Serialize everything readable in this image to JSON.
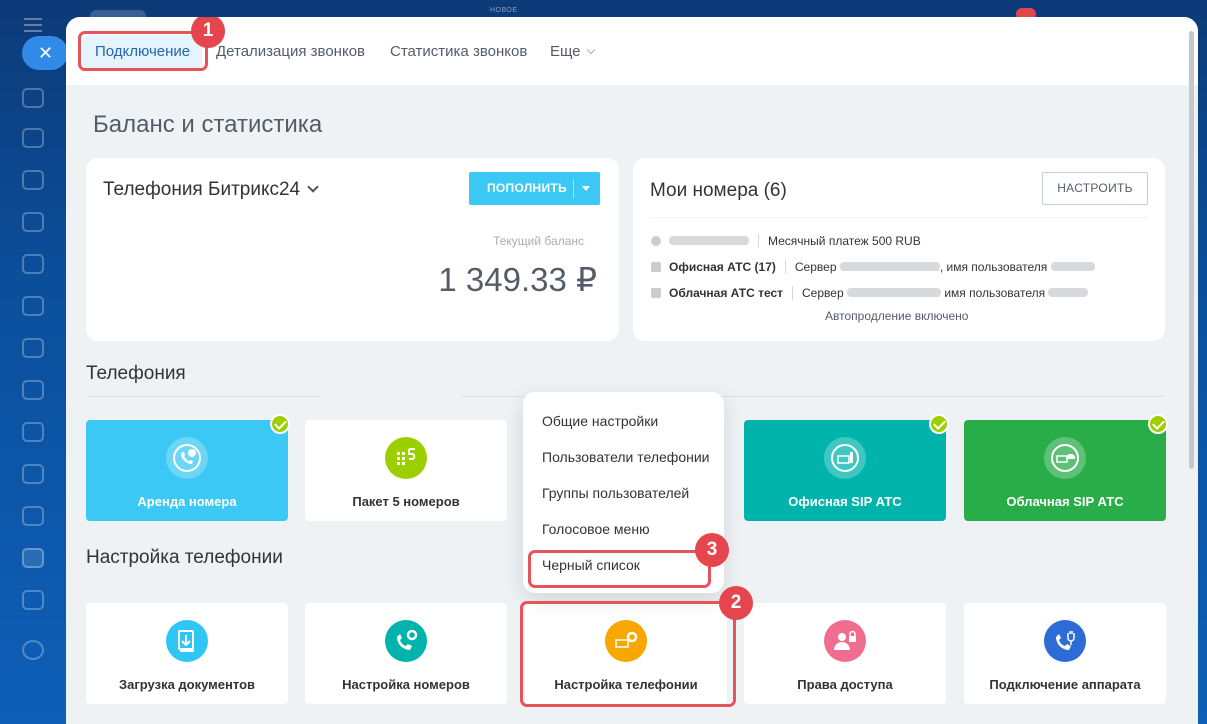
{
  "topbar": {
    "tag": "НОВОЕ"
  },
  "tabs": [
    {
      "label": "Подключение"
    },
    {
      "label": "Детализация звонков"
    },
    {
      "label": "Статистика звонков"
    },
    {
      "label": "Еще"
    }
  ],
  "page_title": "Баланс и статистика",
  "telephony_card": {
    "title": "Телефония Битрикс24",
    "topup_label": "ПОПОЛНИТЬ",
    "balance_label": "Текущий баланс",
    "balance_value": "1 349.33 ₽"
  },
  "numbers_card": {
    "title": "Мои номера (6)",
    "setup_label": "НАСТРОИТЬ",
    "rows": [
      {
        "name": "",
        "detail": "Месячный платеж 500 RUB"
      },
      {
        "name": "Офисная АТС (17)",
        "detail": "Сервер",
        "detail2": "имя пользователя"
      },
      {
        "name": "Облачная АТС тест",
        "detail": "Сервер",
        "detail2": "имя пользователя"
      }
    ],
    "autorenew": "Автопродление включено"
  },
  "section_telephony": "Телефония",
  "tiles_telephony": [
    {
      "label": "Аренда номера",
      "icon": "phone-rent-icon",
      "checked": true
    },
    {
      "label": "Пакет 5 номеров",
      "icon": "pack-5-icon",
      "checked": false
    },
    {
      "label": "Офисная SIP АТС",
      "icon": "office-pbx-icon",
      "checked": true
    },
    {
      "label": "Облачная SIP АТС",
      "icon": "cloud-pbx-icon",
      "checked": true
    }
  ],
  "section_settings": "Настройка телефонии",
  "tiles_settings": [
    {
      "label": "Загрузка документов",
      "icon": "upload-documents-icon"
    },
    {
      "label": "Настройка номеров",
      "icon": "number-settings-icon"
    },
    {
      "label": "Настройка телефонии",
      "icon": "telephony-settings-icon"
    },
    {
      "label": "Права доступа",
      "icon": "access-rights-icon"
    },
    {
      "label": "Подключение аппарата",
      "icon": "device-connect-icon"
    }
  ],
  "dropdown_menu": [
    {
      "label": "Общие настройки"
    },
    {
      "label": "Пользователи телефонии"
    },
    {
      "label": "Группы пользователей"
    },
    {
      "label": "Голосовое меню"
    },
    {
      "label": "Черный список"
    }
  ],
  "callouts": [
    "1",
    "2",
    "3"
  ],
  "colors": {
    "accent": "#3bc8f5",
    "teal": "#00b4ac",
    "green": "#29ad49",
    "highlight": "#e4545a",
    "check": "#9dcf00"
  }
}
